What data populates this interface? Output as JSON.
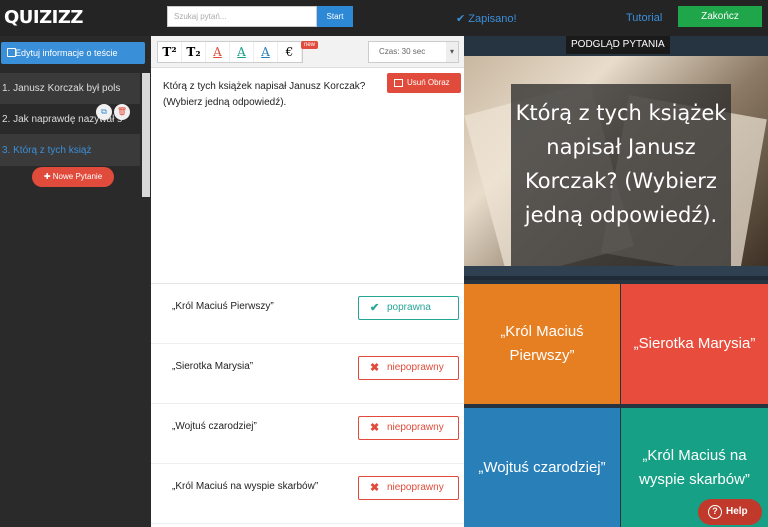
{
  "header": {
    "logo": "QUIZIZZ",
    "search_placeholder": "Szukaj pytań...",
    "search_button": "Start",
    "saved": "✔ Zapisano!",
    "tutorial": "Tutorial",
    "finish": "Zakończ"
  },
  "sidebar": {
    "edit_info": "Edytuj informacje o teście",
    "items": [
      "1. Janusz Korczak był pols",
      "2. Jak naprawdę nazywał s",
      "3. Którą z tych książ"
    ],
    "new_question": "Nowe Pytanie"
  },
  "toolbar": {
    "new_badge": "new",
    "time": "Czas: 30 sec",
    "tools": [
      "T²",
      "T₂",
      "A",
      "A",
      "A",
      "€"
    ]
  },
  "question": {
    "text": "Którą z tych książek napisał Janusz Korczak? (Wybierz jedną odpowiedź).",
    "remove_image": "Usuń Obraz"
  },
  "answers": [
    {
      "text": "„Król Maciuś Pierwszy”",
      "status": "poprawna"
    },
    {
      "text": "„Sierotka Marysia”",
      "status": "niepoprawny"
    },
    {
      "text": "„Wojtuś czarodziej”",
      "status": "niepoprawny"
    },
    {
      "text": "„Król Maciuś na wyspie skarbów”",
      "status": "niepoprawny"
    }
  ],
  "preview": {
    "label": "PODGLĄD PYTANIA",
    "question": "Którą z tych książek napisał Janusz Korczak? (Wybierz jedną odpowiedź).",
    "options": [
      "„Król Maciuś Pierwszy”",
      "„Sierotka Marysia”",
      "„Wojtuś czarodziej”",
      "„Król Maciuś na wyspie skarbów”"
    ]
  },
  "help": "Help",
  "colors": {
    "accent": "#3a8fd9",
    "success": "#1fa54a",
    "danger": "#e14b3b"
  }
}
